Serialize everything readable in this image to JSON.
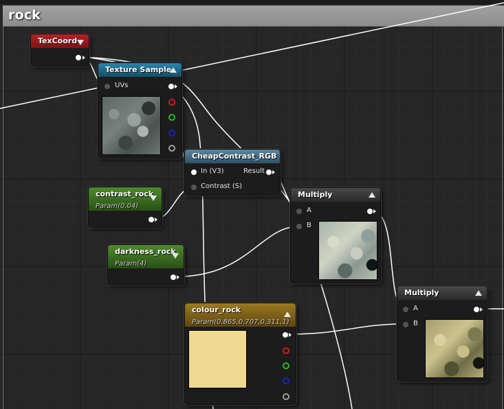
{
  "graph": {
    "comment_title": "rock"
  },
  "nodes": {
    "texcoord": {
      "title": "TexCoord",
      "color": "#a8191c"
    },
    "texture_sample": {
      "title": "Texture Sample",
      "uvs_label": "UVs",
      "color": "#1f6f8f"
    },
    "cheap_contrast": {
      "title": "CheapContrast_RGB",
      "in_label": "In (V3)",
      "result_label": "Result",
      "contrast_label": "Contrast (S)",
      "color": "#45708a"
    },
    "contrast_rock": {
      "title": "contrast_rock",
      "subtitle": "Param(0.04)",
      "color": "#3c6e24"
    },
    "darkness_rock": {
      "title": "darkness_rock",
      "subtitle": "Param(4)",
      "color": "#3c6e24"
    },
    "multiply_1": {
      "title": "Multiply",
      "a_label": "A",
      "b_label": "B",
      "color": "#3a3a3a"
    },
    "multiply_2": {
      "title": "Multiply",
      "a_label": "A",
      "b_label": "B",
      "color": "#3a3a3a"
    },
    "colour_rock": {
      "title": "colour_rock",
      "subtitle": "Param(0.865,0.707,0.311,1)",
      "swatch_color": "#f0d990",
      "color": "#7a5e1a"
    }
  },
  "icons": {
    "collapse": "triangle-icon",
    "pin": "pin-icon"
  }
}
